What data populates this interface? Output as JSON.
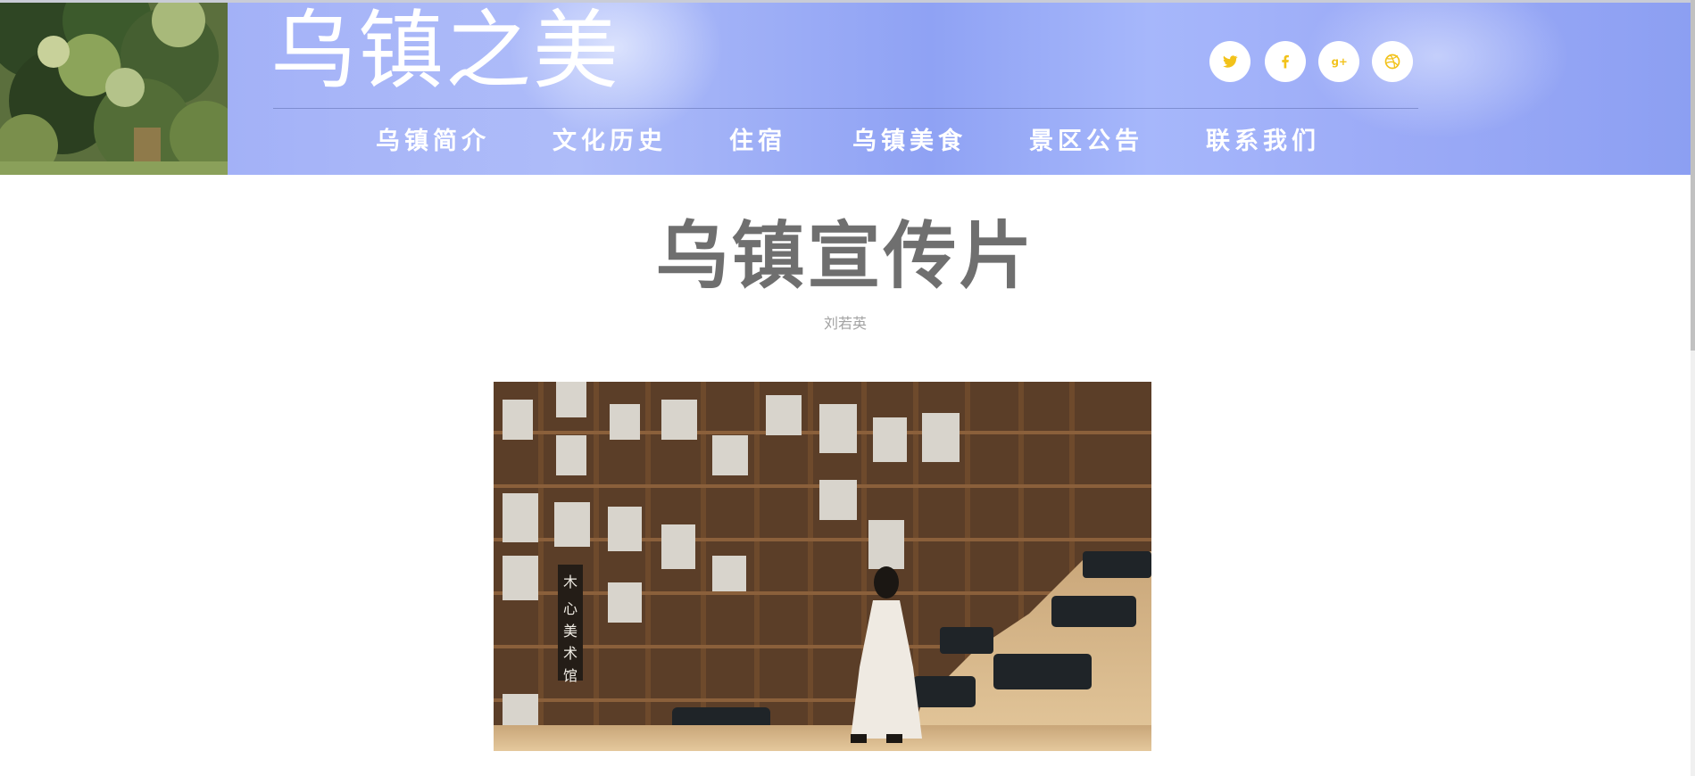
{
  "site": {
    "title": "乌镇之美"
  },
  "social": [
    {
      "name": "twitter-icon"
    },
    {
      "name": "facebook-icon"
    },
    {
      "name": "google-plus-icon"
    },
    {
      "name": "dribbble-icon"
    }
  ],
  "nav": {
    "items": [
      {
        "label": "乌镇简介"
      },
      {
        "label": "文化历史"
      },
      {
        "label": "住宿"
      },
      {
        "label": "乌镇美食"
      },
      {
        "label": "景区公告"
      },
      {
        "label": "联系我们"
      }
    ]
  },
  "main": {
    "title": "乌镇宣传片",
    "author": "刘若英",
    "image_caption": "木心美术馆"
  },
  "colors": {
    "header_blue": "#9aa9f5",
    "social_icon": "#f2c21a",
    "title_gray": "#6f6f6f"
  }
}
